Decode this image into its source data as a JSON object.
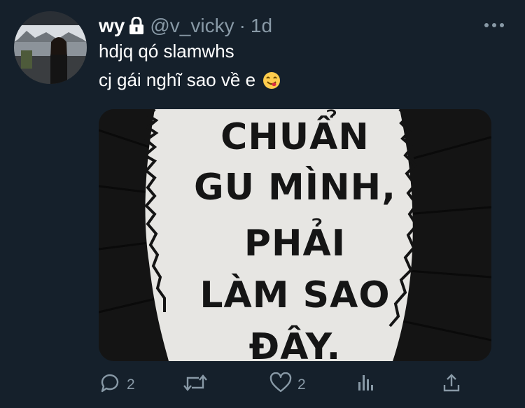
{
  "tweet": {
    "display_name": "wy",
    "handle": "@v_vicky",
    "separator": "·",
    "time": "1d",
    "lines": [
      "hdjq qó slamwhs",
      "cj gái nghĩ sao về e"
    ],
    "emoji": "face-savoring-food",
    "media": {
      "lines": [
        "CHUẨN",
        "GU MÌNH,",
        "PHẢI",
        "LÀM SAO",
        "ĐÂY."
      ]
    },
    "actions": {
      "reply_count": "2",
      "retweet_count": "",
      "like_count": "2"
    },
    "colors": {
      "background": "#15202b",
      "text": "#ffffff",
      "secondary": "#8899a6"
    }
  }
}
